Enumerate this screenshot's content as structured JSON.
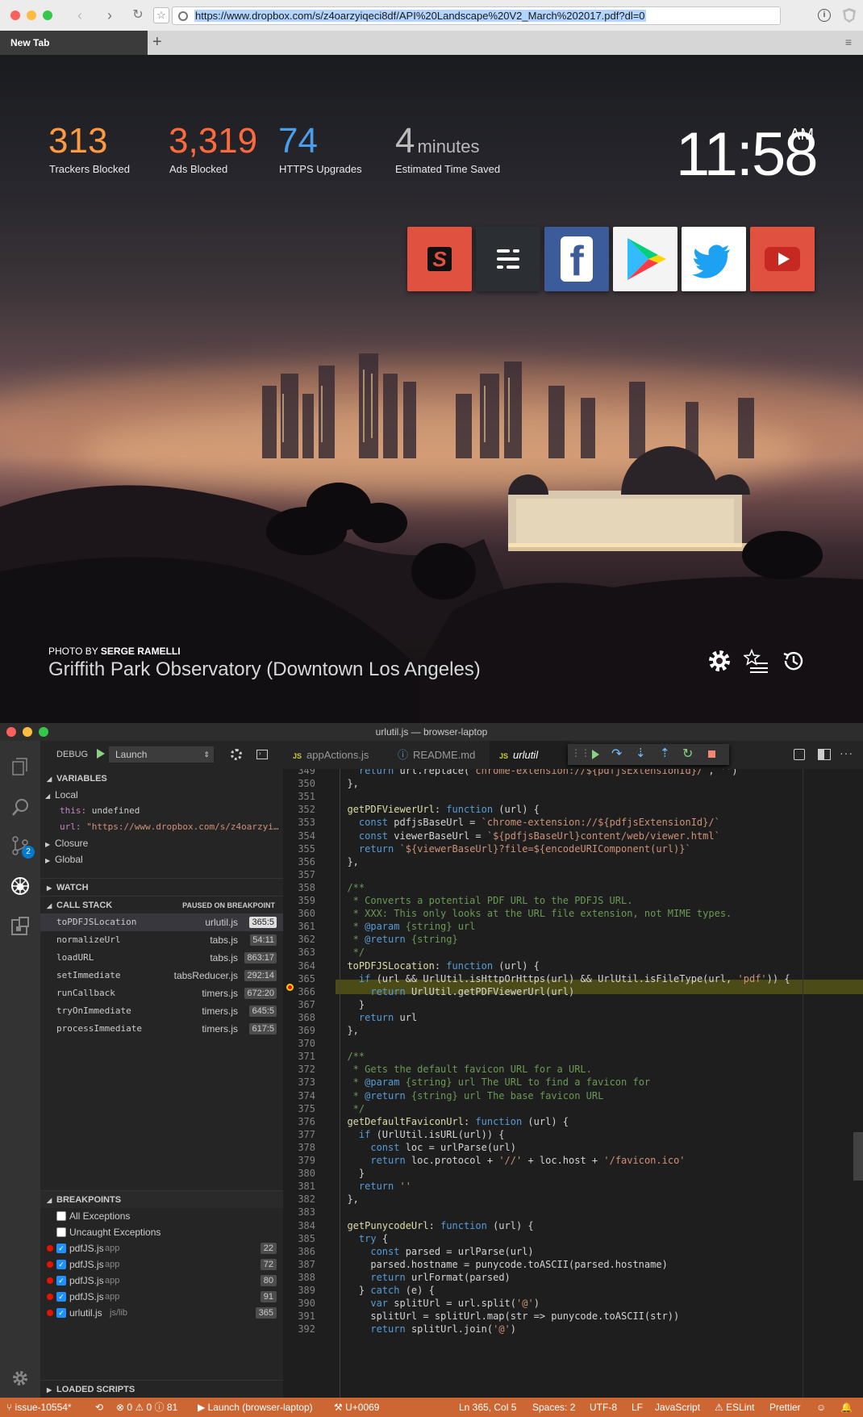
{
  "browser": {
    "url": "https://www.dropbox.com/s/z4oarzyiqeci8df/API%20Landscape%20V2_March%202017.pdf?dl=0",
    "tab_title": "New Tab",
    "new_tab_glyph": "+",
    "menu_glyph": "≡"
  },
  "ntp": {
    "stats": [
      {
        "value": "313",
        "label": "Trackers Blocked",
        "color": "#ff9a40"
      },
      {
        "value": "3,319",
        "label": "Ads Blocked",
        "color": "#ff6a3d"
      },
      {
        "value": "74",
        "label": "HTTPS Upgrades",
        "color": "#4a9eea"
      },
      {
        "value": "4",
        "unit": "minutes",
        "label": "Estimated Time Saved",
        "color": "#bbbbbb"
      }
    ],
    "clock": {
      "time": "11:58",
      "ampm": "AM"
    },
    "tiles": [
      {
        "name": "s-tile",
        "color": "#e0513f"
      },
      {
        "name": "menu-tile",
        "color": "#2b2f33"
      },
      {
        "name": "facebook-tile",
        "color": "#3b5b9a"
      },
      {
        "name": "google-play-tile",
        "color": "#f4f4f4"
      },
      {
        "name": "twitter-tile",
        "color": "#ffffff"
      },
      {
        "name": "youtube-tile",
        "color": "#e0513f"
      }
    ],
    "photo_by_prefix": "PHOTO BY ",
    "photo_by_name": "SERGE RAMELLI",
    "photo_title": "Griffith Park Observatory (Downtown Los Angeles)"
  },
  "vscode": {
    "title": "urlutil.js — browser-laptop",
    "debug": {
      "label": "DEBUG",
      "config": "Launch"
    },
    "variables": {
      "header": "VARIABLES",
      "local": "Local",
      "this_key": "this:",
      "this_val": "undefined",
      "url_key": "url:",
      "url_val": "\"https://www.dropbox.com/s/z4oarzyi…",
      "closure": "Closure",
      "global": "Global"
    },
    "watch_header": "WATCH",
    "callstack": {
      "header": "CALL STACK",
      "status": "PAUSED ON BREAKPOINT",
      "frames": [
        {
          "name": "toPDFJSLocation",
          "file": "urlutil.js",
          "pos": "365:5"
        },
        {
          "name": "normalizeUrl",
          "file": "tabs.js",
          "pos": "54:11"
        },
        {
          "name": "loadURL",
          "file": "tabs.js",
          "pos": "863:17"
        },
        {
          "name": "setImmediate",
          "file": "tabsReducer.js",
          "pos": "292:14"
        },
        {
          "name": "runCallback",
          "file": "timers.js",
          "pos": "672:20"
        },
        {
          "name": "tryOnImmediate",
          "file": "timers.js",
          "pos": "645:5"
        },
        {
          "name": "processImmediate",
          "file": "timers.js",
          "pos": "617:5"
        }
      ]
    },
    "breakpoints": {
      "header": "BREAKPOINTS",
      "all": "All Exceptions",
      "uncaught": "Uncaught Exceptions",
      "items": [
        {
          "file": "pdfJS.js",
          "dir": "app",
          "line": "22"
        },
        {
          "file": "pdfJS.js",
          "dir": "app",
          "line": "72"
        },
        {
          "file": "pdfJS.js",
          "dir": "app",
          "line": "80"
        },
        {
          "file": "pdfJS.js",
          "dir": "app",
          "line": "91"
        },
        {
          "file": "urlutil.js",
          "dir": "js/lib",
          "line": "365"
        }
      ]
    },
    "loaded_scripts": "LOADED SCRIPTS",
    "tabs": [
      {
        "label": "appActions.js",
        "icon": "JS"
      },
      {
        "label": "README.md",
        "icon": "ⓘ"
      },
      {
        "label": "urlutil",
        "icon": "JS"
      }
    ],
    "code": [
      {
        "n": "349",
        "t": "    return url.replace(`chrome-extension://${pdfjsExtensionId}/`, '')"
      },
      {
        "n": "350",
        "t": "  },"
      },
      {
        "n": "351",
        "t": ""
      },
      {
        "n": "352",
        "t": "  getPDFViewerUrl: function (url) {"
      },
      {
        "n": "353",
        "t": "    const pdfjsBaseUrl = `chrome-extension://${pdfjsExtensionId}/`"
      },
      {
        "n": "354",
        "t": "    const viewerBaseUrl = `${pdfjsBaseUrl}content/web/viewer.html`"
      },
      {
        "n": "355",
        "t": "    return `${viewerBaseUrl}?file=${encodeURIComponent(url)}`"
      },
      {
        "n": "356",
        "t": "  },"
      },
      {
        "n": "357",
        "t": ""
      },
      {
        "n": "358",
        "t": "  /**"
      },
      {
        "n": "359",
        "t": "   * Converts a potential PDF URL to the PDFJS URL."
      },
      {
        "n": "360",
        "t": "   * XXX: This only looks at the URL file extension, not MIME types."
      },
      {
        "n": "361",
        "t": "   * @param {string} url"
      },
      {
        "n": "362",
        "t": "   * @return {string}"
      },
      {
        "n": "363",
        "t": "   */"
      },
      {
        "n": "364",
        "t": "  toPDFJSLocation: function (url) {"
      },
      {
        "n": "365",
        "t": "    if (url && UrlUtil.isHttpOrHttps(url) && UrlUtil.isFileType(url, 'pdf')) {"
      },
      {
        "n": "366",
        "t": "      return UrlUtil.getPDFViewerUrl(url)"
      },
      {
        "n": "367",
        "t": "    }"
      },
      {
        "n": "368",
        "t": "    return url"
      },
      {
        "n": "369",
        "t": "  },"
      },
      {
        "n": "370",
        "t": ""
      },
      {
        "n": "371",
        "t": "  /**"
      },
      {
        "n": "372",
        "t": "   * Gets the default favicon URL for a URL."
      },
      {
        "n": "373",
        "t": "   * @param {string} url The URL to find a favicon for"
      },
      {
        "n": "374",
        "t": "   * @return {string} url The base favicon URL"
      },
      {
        "n": "375",
        "t": "   */"
      },
      {
        "n": "376",
        "t": "  getDefaultFaviconUrl: function (url) {"
      },
      {
        "n": "377",
        "t": "    if (UrlUtil.isURL(url)) {"
      },
      {
        "n": "378",
        "t": "      const loc = urlParse(url)"
      },
      {
        "n": "379",
        "t": "      return loc.protocol + '//' + loc.host + '/favicon.ico'"
      },
      {
        "n": "380",
        "t": "    }"
      },
      {
        "n": "381",
        "t": "    return ''"
      },
      {
        "n": "382",
        "t": "  },"
      },
      {
        "n": "383",
        "t": ""
      },
      {
        "n": "384",
        "t": "  getPunycodeUrl: function (url) {"
      },
      {
        "n": "385",
        "t": "    try {"
      },
      {
        "n": "386",
        "t": "      const parsed = urlParse(url)"
      },
      {
        "n": "387",
        "t": "      parsed.hostname = punycode.toASCII(parsed.hostname)"
      },
      {
        "n": "388",
        "t": "      return urlFormat(parsed)"
      },
      {
        "n": "389",
        "t": "    } catch (e) {"
      },
      {
        "n": "390",
        "t": "      var splitUrl = url.split('@')"
      },
      {
        "n": "391",
        "t": "      splitUrl = splitUrl.map(str => punycode.toASCII(str))"
      },
      {
        "n": "392",
        "t": "      return splitUrl.join('@')"
      }
    ],
    "status": {
      "branch": "issue-10554*",
      "errors": "0",
      "warnings": "0",
      "infos": "81",
      "launch": "Launch (browser-laptop)",
      "unicode": "U+0069",
      "position": "Ln 365, Col 5",
      "spaces": "Spaces: 2",
      "encoding": "UTF-8",
      "eol": "LF",
      "language": "JavaScript",
      "eslint": "ESLint",
      "prettier": "Prettier"
    },
    "scm_badge": "2"
  }
}
